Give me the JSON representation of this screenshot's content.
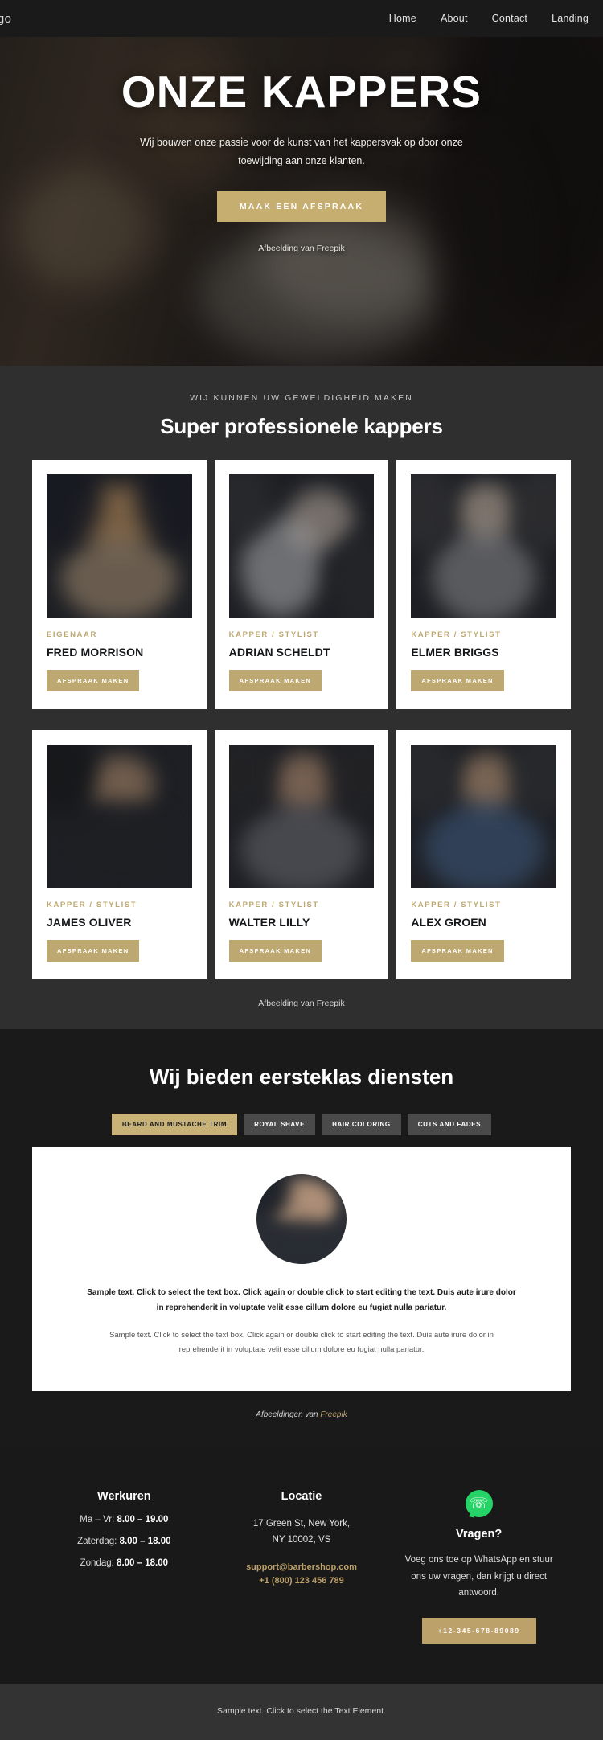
{
  "header": {
    "logo": "ogo",
    "nav": [
      {
        "label": "Home"
      },
      {
        "label": "About"
      },
      {
        "label": "Contact"
      },
      {
        "label": "Landing"
      }
    ]
  },
  "hero": {
    "title": "ONZE KAPPERS",
    "subtitle": "Wij bouwen onze passie voor de kunst van het kappersvak op door onze toewijding aan onze klanten.",
    "cta": "MAAK EEN AFSPRAAK",
    "credit_prefix": "Afbeelding van ",
    "credit_link": "Freepik"
  },
  "team": {
    "eyebrow": "WIJ KUNNEN UW GEWELDIGHEID MAKEN",
    "title": "Super professionele kappers",
    "button_label": "AFSPRAAK MAKEN",
    "credit_prefix": "Afbeelding van ",
    "credit_link": "Freepik",
    "members": [
      {
        "role": "EIGENAAR",
        "name": "FRED MORRISON"
      },
      {
        "role": "KAPPER / STYLIST",
        "name": "ADRIAN SCHELDT"
      },
      {
        "role": "KAPPER / STYLIST",
        "name": "ELMER BRIGGS"
      },
      {
        "role": "KAPPER / STYLIST",
        "name": "JAMES OLIVER"
      },
      {
        "role": "KAPPER / STYLIST",
        "name": "WALTER LILLY"
      },
      {
        "role": "KAPPER / STYLIST",
        "name": "ALEX GROEN"
      }
    ]
  },
  "services": {
    "title": "Wij bieden eersteklas diensten",
    "tabs": [
      {
        "label": "BEARD AND MUSTACHE TRIM",
        "active": true
      },
      {
        "label": "ROYAL SHAVE",
        "active": false
      },
      {
        "label": "HAIR COLORING",
        "active": false
      },
      {
        "label": "CUTS AND FADES",
        "active": false
      }
    ],
    "lead": "Sample text. Click to select the text box. Click again or double click to start editing the text. Duis aute irure dolor in reprehenderit in voluptate velit esse cillum dolore eu fugiat nulla pariatur.",
    "body": "Sample text. Click to select the text box. Click again or double click to start editing the text. Duis aute irure dolor in reprehenderit in voluptate velit esse cillum dolore eu fugiat nulla pariatur.",
    "credit_prefix": "Afbeeldingen van ",
    "credit_link": "Freepik"
  },
  "footer": {
    "hours": {
      "title": "Werkuren",
      "rows": [
        {
          "label": "Ma – Vr: ",
          "value": "8.00 – 19.00"
        },
        {
          "label": "Zaterdag: ",
          "value": "8.00 – 18.00"
        },
        {
          "label": "Zondag: ",
          "value": "8.00 – 18.00"
        }
      ]
    },
    "location": {
      "title": "Locatie",
      "address_line1": "17 Green St, New York,",
      "address_line2": "NY 10002, VS",
      "email": "support@barbershop.com",
      "phone": "+1 (800) 123 456 789"
    },
    "questions": {
      "icon": "whatsapp-icon",
      "title": "Vragen?",
      "body": "Voeg ons toe op WhatsApp en stuur ons uw vragen, dan krijgt u direct antwoord.",
      "button_label": "+12-345-678-89089"
    },
    "bottom_text": "Sample text. Click to select the Text Element."
  },
  "colors": {
    "gold": "#bda871",
    "gold_light": "#c9b278",
    "dark": "#1a1a1a",
    "panel": "#2f2f2f",
    "whatsapp_green": "#25d366"
  }
}
